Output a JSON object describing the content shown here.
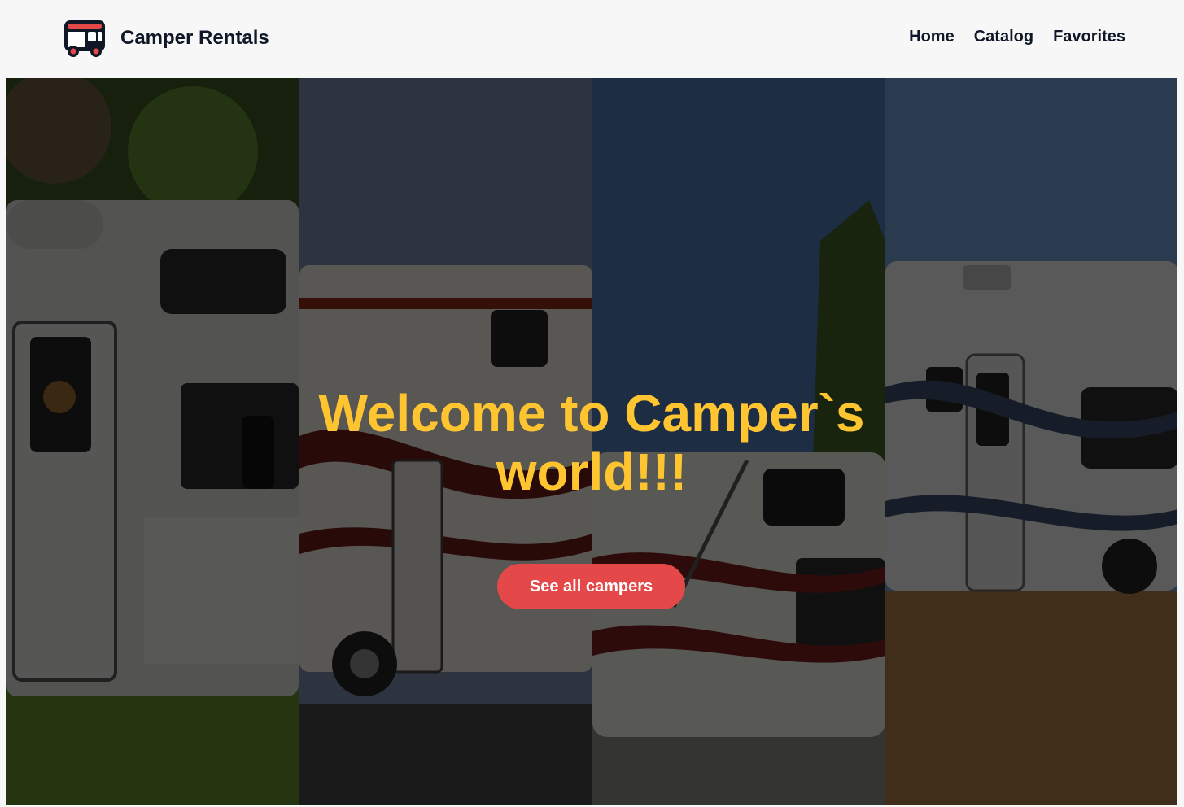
{
  "brand": {
    "name": "Camper Rentals",
    "icon": "camper-van-icon",
    "colors": {
      "body": "#101828",
      "stripe": "#e44848"
    }
  },
  "nav": {
    "items": [
      {
        "label": "Home"
      },
      {
        "label": "Catalog"
      },
      {
        "label": "Favorites"
      }
    ]
  },
  "hero": {
    "title": "Welcome to Camper`s world!!!",
    "cta_label": "See all campers",
    "images": [
      "camper-photo-1",
      "camper-photo-2",
      "camper-photo-3",
      "camper-photo-4"
    ]
  },
  "colors": {
    "accent": "#e44848",
    "title": "#ffc531",
    "text": "#101828",
    "background": "#f7f7f7"
  }
}
